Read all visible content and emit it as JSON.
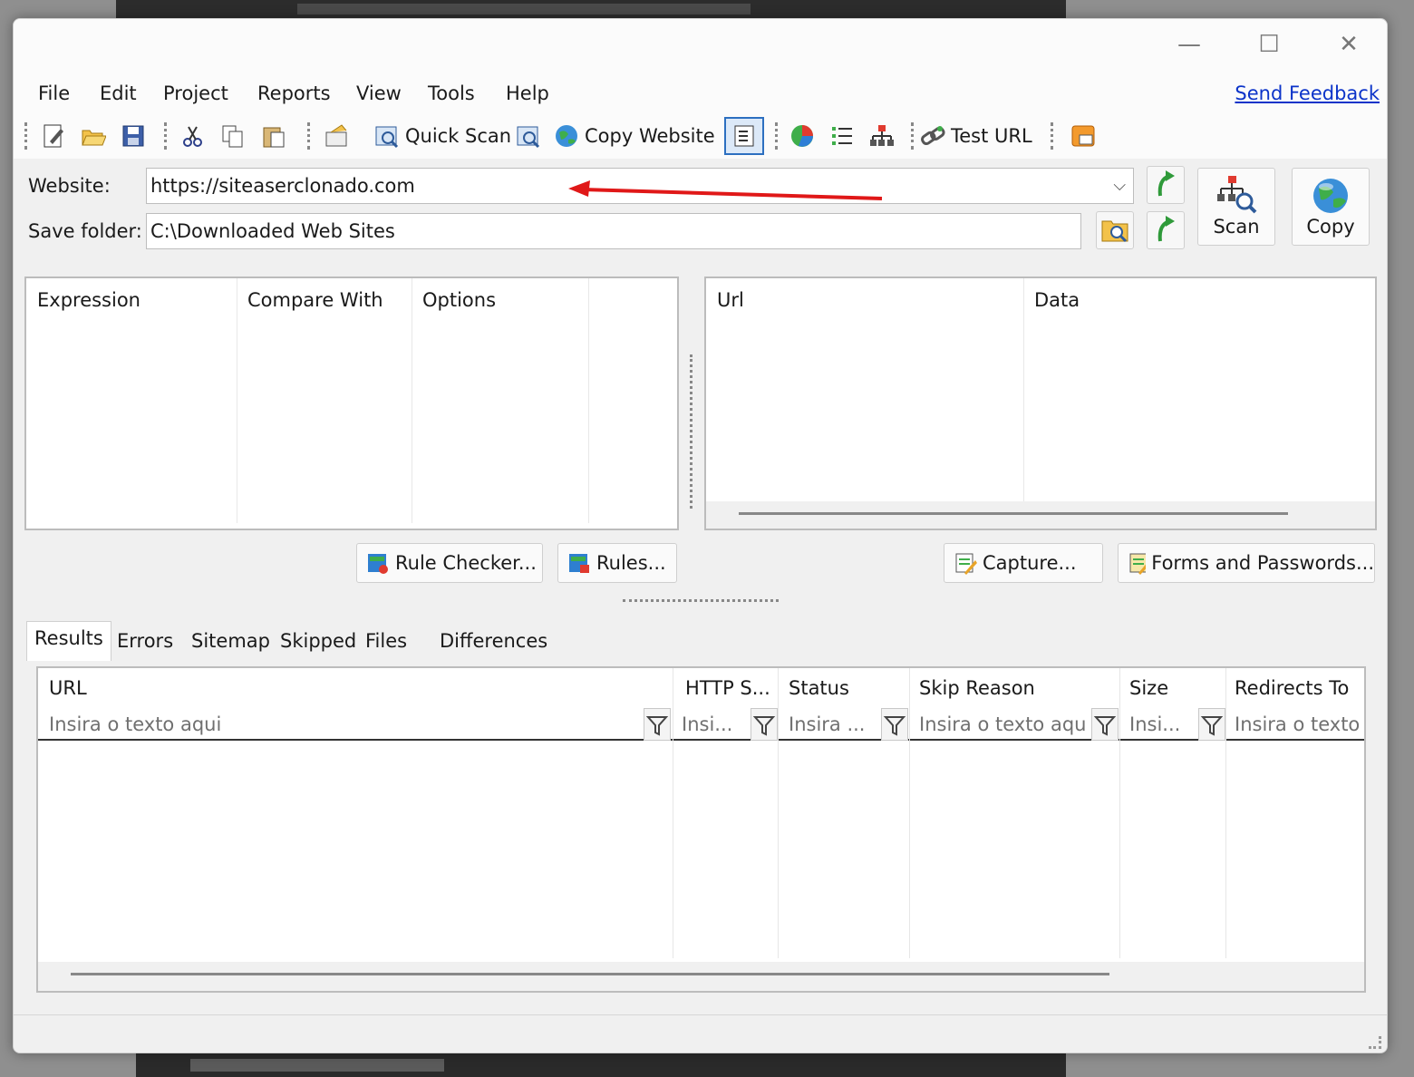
{
  "window": {
    "minimize": "—",
    "maximize": "☐",
    "close": "✕"
  },
  "menu": {
    "items": [
      "File",
      "Edit",
      "Project",
      "Reports",
      "View",
      "Tools",
      "Help"
    ],
    "feedback": "Send Feedback"
  },
  "toolbar": {
    "quick_scan": "Quick Scan",
    "copy_website": "Copy Website",
    "test_url": "Test URL"
  },
  "form": {
    "website_label": "Website:",
    "website_value": "https://siteaserclonado.com",
    "save_folder_label": "Save folder:",
    "save_folder_value": "C:\\Downloaded Web Sites",
    "scan_label": "Scan",
    "copy_label": "Copy"
  },
  "rules_panel": {
    "columns": [
      "Expression",
      "Compare With",
      "Options"
    ]
  },
  "data_panel": {
    "columns": [
      "Url",
      "Data"
    ]
  },
  "buttons": {
    "rule_checker": "Rule Checker...",
    "rules": "Rules...",
    "capture": "Capture...",
    "forms_passwords": "Forms and Passwords..."
  },
  "tabs": [
    "Results",
    "Errors",
    "Sitemap",
    "Skipped",
    "Files",
    "Differences"
  ],
  "results_grid": {
    "columns": [
      {
        "header": "URL",
        "filter": "Insira o texto aqui"
      },
      {
        "header": "HTTP S...",
        "filter": "Insi..."
      },
      {
        "header": "Status",
        "filter": "Insira ..."
      },
      {
        "header": "Skip Reason",
        "filter": "Insira o texto aqui"
      },
      {
        "header": "Size",
        "filter": "Insi..."
      },
      {
        "header": "Redirects To",
        "filter": "Insira o texto a"
      }
    ]
  },
  "colors": {
    "accent_link": "#0b33c9",
    "arrow_annotation": "#e01818"
  }
}
